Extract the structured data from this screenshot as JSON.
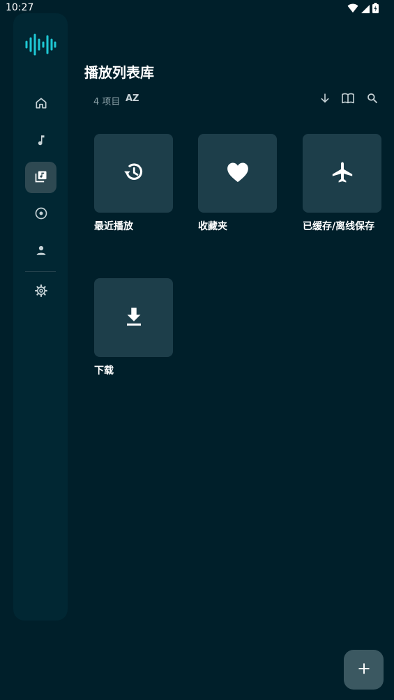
{
  "status_bar": {
    "time": "10:27",
    "icons": [
      "wifi-icon",
      "cell-signal-icon",
      "battery-icon"
    ]
  },
  "sidebar": {
    "logo": "waveform-logo",
    "items": [
      {
        "name": "home",
        "icon": "home-icon",
        "active": false
      },
      {
        "name": "songs",
        "icon": "music-note-icon",
        "active": false
      },
      {
        "name": "playlists",
        "icon": "library-music-icon",
        "active": true
      },
      {
        "name": "albums",
        "icon": "album-icon",
        "active": false
      },
      {
        "name": "artists",
        "icon": "person-icon",
        "active": false
      },
      {
        "name": "settings",
        "icon": "gear-icon",
        "active": false
      }
    ]
  },
  "header": {
    "title": "播放列表库",
    "item_count": "4 项目",
    "sort_label": "AZ",
    "actions": [
      "arrow-down-icon",
      "book-icon",
      "search-icon"
    ]
  },
  "playlists": [
    {
      "label": "最近播放",
      "icon": "history-icon"
    },
    {
      "label": "收藏夹",
      "icon": "heart-icon"
    },
    {
      "label": "已缓存/离线保存",
      "icon": "airplane-icon"
    },
    {
      "label": "下载",
      "icon": "download-icon"
    }
  ],
  "fab": {
    "icon": "plus-icon"
  },
  "colors": {
    "background": "#001f2a",
    "sidebar": "#012733",
    "tile": "#1d3e4a",
    "accent": "#1ec8d4",
    "fab": "#3b5861"
  }
}
